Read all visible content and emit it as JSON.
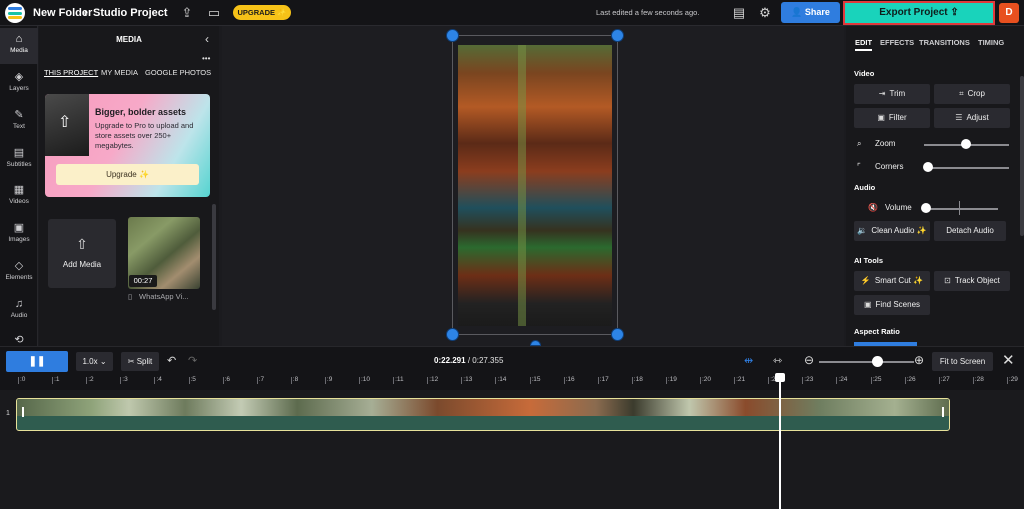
{
  "topbar": {
    "breadcrumb_folder": "New Folder",
    "breadcrumb_sep": "›",
    "project_name": "Studio Project",
    "upgrade_label": "UPGRADE",
    "upgrade_sparkle": "✨",
    "last_edited": "Last edited a few seconds ago.",
    "share_label": "Share",
    "export_label": "Export Project",
    "avatar_initial": "D"
  },
  "rail": {
    "items": [
      {
        "label": "Media",
        "icon": "⌂"
      },
      {
        "label": "Layers",
        "icon": "◈"
      },
      {
        "label": "Text",
        "icon": "✎"
      },
      {
        "label": "Subtitles",
        "icon": "▤"
      },
      {
        "label": "Videos",
        "icon": "▦"
      },
      {
        "label": "Images",
        "icon": "▣"
      },
      {
        "label": "Elements",
        "icon": "◇"
      },
      {
        "label": "Audio",
        "icon": "♫"
      },
      {
        "label": "",
        "icon": "⟲"
      }
    ]
  },
  "media": {
    "title": "MEDIA",
    "more": "•••",
    "tabs": [
      "THIS PROJECT",
      "MY MEDIA",
      "GOOGLE PHOTOS"
    ],
    "promo_heading": "Bigger, bolder assets",
    "promo_body": "Upgrade to Pro to upload and store assets over 250+ megabytes.",
    "promo_button": "Upgrade ✨",
    "add_media_label": "Add Media",
    "clip_duration": "00:27",
    "clip_name": "WhatsApp Vi..."
  },
  "props": {
    "tabs": [
      "EDIT",
      "EFFECTS",
      "TRANSITIONS",
      "TIMING"
    ],
    "video_section": "Video",
    "trim": "Trim",
    "crop": "Crop",
    "filter": "Filter",
    "adjust": "Adjust",
    "zoom": "Zoom",
    "corners": "Corners",
    "audio_section": "Audio",
    "volume": "Volume",
    "clean_audio": "Clean Audio ✨",
    "detach_audio": "Detach Audio",
    "ai_section": "AI Tools",
    "smart_cut": "Smart Cut ✨",
    "track_object": "Track Object",
    "find_scenes": "Find Scenes",
    "aspect_section": "Aspect Ratio"
  },
  "timeline": {
    "play_icon": "❚❚",
    "speed": "1.0x",
    "split": "Split",
    "current_time": "0:22.291",
    "total_time": "0:27.355",
    "fit_label": "Fit to Screen",
    "track_number": "1",
    "ruler_marks": [
      ":0",
      ":1",
      ":2",
      ":3",
      ":4",
      ":5",
      ":6",
      ":7",
      ":8",
      ":9",
      ":10",
      ":11",
      ":12",
      ":13",
      ":14",
      ":15",
      ":16",
      ":17",
      ":18",
      ":19",
      ":20",
      ":21",
      ":22",
      ":23",
      ":24",
      ":25",
      ":26",
      ":27",
      ":28",
      ":29"
    ],
    "playhead_seconds": 22.291,
    "zoom_level": 0.62
  },
  "colors": {
    "accent_blue": "#2f7ddf",
    "export_teal": "#19d3bb",
    "upgrade_yellow": "#f6c218"
  }
}
